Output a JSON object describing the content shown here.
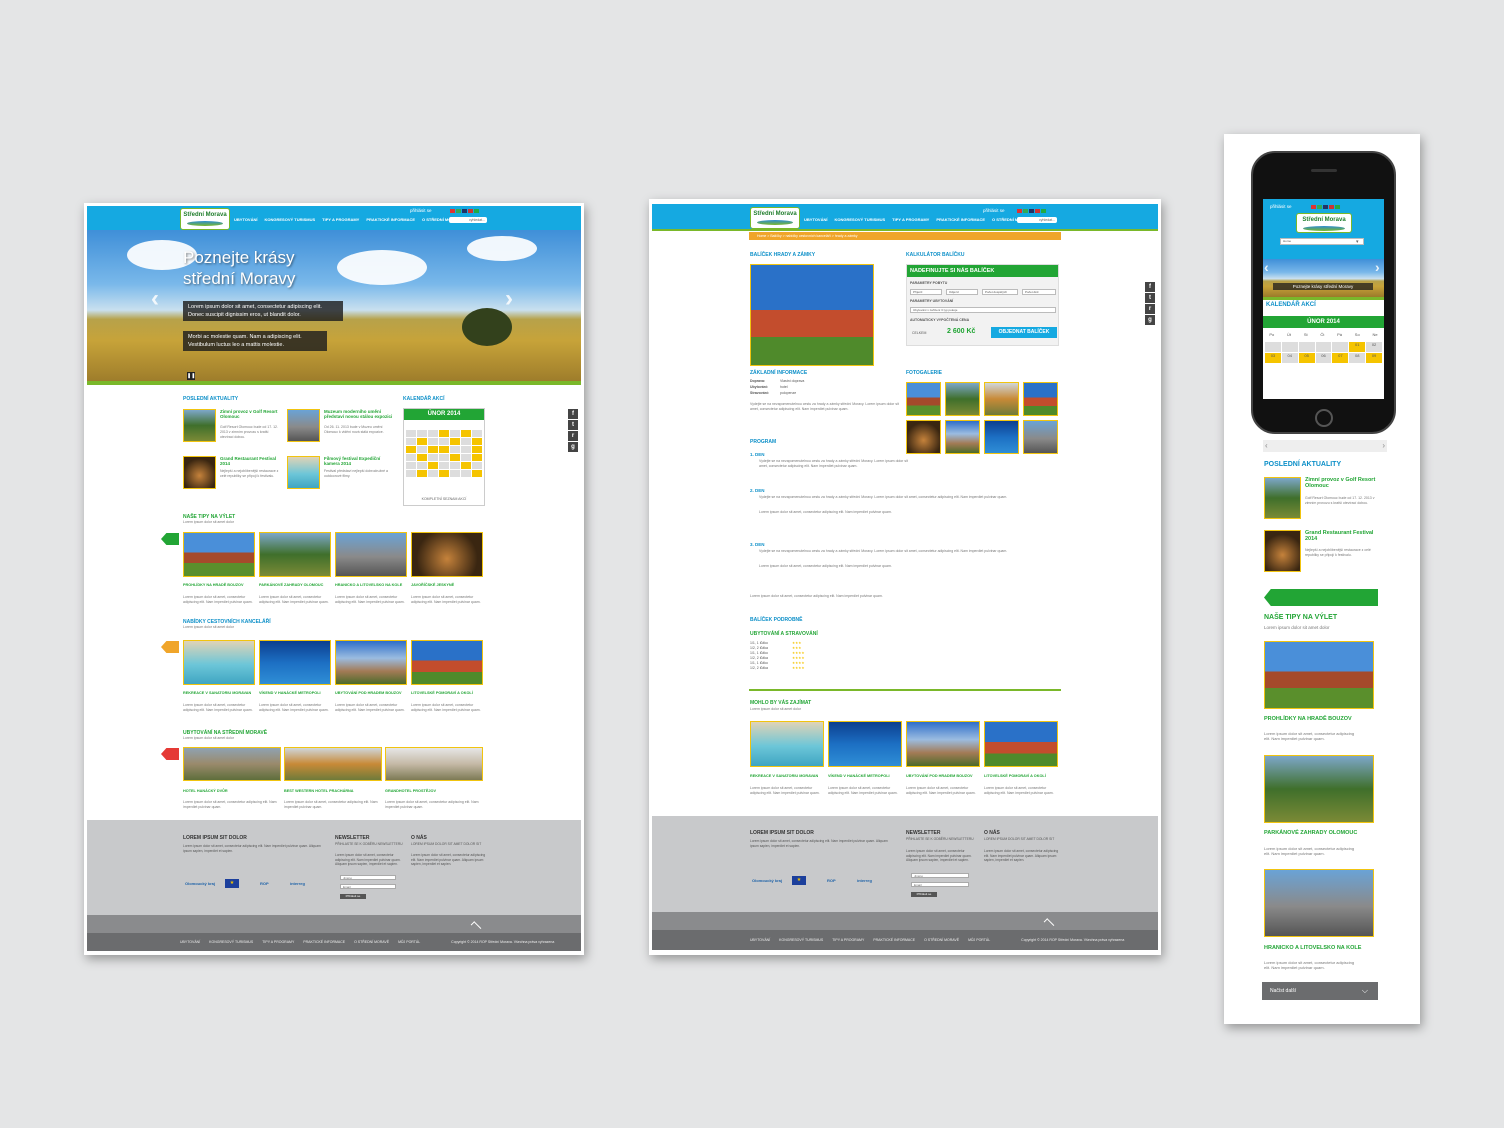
{
  "logo_text": "Střední Morava",
  "menu": [
    "UBYTOVÁNÍ",
    "KONGRESOVÝ TURISMUS",
    "TIPY A PROGRAMY",
    "PRAKTICKÉ INFORMACE",
    "O STŘEDNÍ MORAVĚ"
  ],
  "login": "přihlásit  se",
  "search_placeholder": "vyhledat...",
  "home": {
    "hero_title_1": "Poznejte krásy",
    "hero_title_2": "střední Moravy",
    "hero_text_1": "Lorem ipsum dolor sit amet, consectetur adipiscing elit. Donec suscipit dignissim eros, ut blandit dolor.",
    "hero_text_2": "Morbi ac molestie quam. Nam a adipiscing elit. Vestibulum luctus leo a mattis molestie.",
    "news_title": "POSLEDNÍ AKTUALITY",
    "news": [
      {
        "title": "Zimní provoz v Golf Resort Olomouc",
        "text": "Golf Resort Olomouc bude od 17. 12. 2013 v zimním provozu s kratší otevírací dobou."
      },
      {
        "title": "Muzeum moderního umění představí novou stálou expozici",
        "text": "Od 26. 11. 2013 bude v Muzeu umění Olomouc k vidění nová stálá expozice."
      },
      {
        "title": "Grand Restaurant Festival 2014",
        "text": "Nejlepší a nejoblíbenější restaurace z celé republiky se připojí k festivalu."
      },
      {
        "title": "Filmový festival Expediční kamera 2014",
        "text": "Festival představí nejlepší dobrodružné a outdoorové filmy."
      }
    ],
    "calendar_title": "KALENDÁŘ AKCÍ",
    "calendar_month": "ÚNOR 2014",
    "calendar_days": [
      "Po",
      "Út",
      "St",
      "Čt",
      "Pá",
      "So",
      "Ne"
    ],
    "calendar_link": "KOMPLETNÍ SEZNAM AKCÍ",
    "tips_title": "NAŠE TIPY NA VÝLET",
    "tips_sub": "Lorem ipsum dolor sit amet dolor",
    "tips": [
      "PROHLÍDKY NA HRADĚ BOUZOV",
      "PARKÁNOVÉ ZAHRADY OLOMOUC",
      "HRANICKO A LITOVELSKO NA KOLE",
      "JAVOŘÍČSKÉ JESKYNĚ"
    ],
    "item_text": "Lorem ipsum dolor sit amet, consectetur adipiscing elit. Nam imperdiet pulvinar quam.",
    "agencies_title": "NABÍDKY CESTOVNÍCH KANCELÁŘÍ",
    "agencies_sub": "Lorem ipsum dolor sit amet dolor",
    "agencies": [
      "REKREACE V SANATORIU MORAVAN",
      "VÍKEND V HANÁCKÉ METROPOLI",
      "UBYTOVÁNÍ POD HRADEM BOUZOV",
      "LITOVELSKÉ POMORAVÍ A OKOLÍ"
    ],
    "stay_title": "UBYTOVÁNÍ NA STŘEDNÍ MORAVĚ",
    "stay_sub": "Lorem ipsum dolor sit amet dolor",
    "stays": [
      "HOTEL HANÁCKÝ DVŮR",
      "BEST WESTERN HOTEL PRACHÁRNA",
      "GRANDHOTEL PROSTĚJOV"
    ]
  },
  "footer": {
    "col1_title": "LOREM IPSUM SIT DOLOR",
    "col1_text": "Lorem ipsum dolor sit amet, consectetur adipiscing elit. Nam imperdiet pulvinar quam. Aliquam ipsum sapien, imperdiet et sapien.",
    "newsletter_title": "NEWSLETTER",
    "newsletter_sub": "PŘIHLASTE SE K ODBĚRU NEWSLETTERU",
    "name_ph": "Jméno",
    "email_ph": "Email",
    "subscribe": "Přihlásit se",
    "about_title": "O NÁS",
    "about_text": "LOREM IPSUM DOLOR SIT AMET DOLOR SIT",
    "logos": [
      "Olomoucký kraj",
      "ROP",
      "interreg"
    ],
    "copyright": "Copyright © 2014 ROP Střední Morava. Všechna práva vyhrazena",
    "bottom_menu": [
      "UBYTOVÁNÍ",
      "KONGRESOVÝ TURISMUS",
      "TIPY A PROGRAMY",
      "PRAKTICKÉ INFORMACE",
      "O STŘEDNÍ MORAVĚ",
      "MŮJ PORTÁL"
    ]
  },
  "detail": {
    "breadcrumb": "Home > Balíčky > nabídky cestovních kanceláří > hrady a zámky",
    "package_title": "BALÍČEK HRADY A ZÁMKY",
    "calc_title": "KALKULÁTOR BALÍČKU",
    "calc_head": "NADEFINUJTE SI NÁS BALÍČEK",
    "calc_params": "PARAMETRY POBYTU",
    "calc_selects": [
      "Příjezd",
      "Odjezd",
      "Počet dospělých",
      "Počet dětí"
    ],
    "calc_accom": "PARAMETRY UBYTOVÁNÍ",
    "calc_accom_select": "Ubytování v zařízení 3 typ pokoje",
    "calc_price_label": "AUTOMATICKY VYPOČTENÁ CENA",
    "calc_total_label": "CELKEM",
    "calc_price": "2 600 Kč",
    "calc_button": "OBJEDNAT BALÍČEK",
    "basic_info": "ZÁKLADNÍ INFORMACE",
    "info": [
      [
        "Doprava:",
        "Vlastní doprava"
      ],
      [
        "Ubytování:",
        "hotel"
      ],
      [
        "Stravování:",
        "polopenze"
      ]
    ],
    "gallery": "FOTOGALERIE",
    "program": "PROGRAM",
    "days": [
      "1. DEN",
      "2. DEN",
      "3. DEN"
    ],
    "detail_title": "BALÍČEK PODROBNĚ",
    "accom_title": "UBYTOVÁNÍ A STRAVOVÁNÍ",
    "rooms": [
      "1/1, 1 lůžko",
      "1/2, 2 lůžka",
      "1/1, 1 lůžko",
      "1/2, 2 lůžka",
      "1/1, 1 lůžko",
      "1/2, 2 lůžka"
    ],
    "related_title": "MOHLO BY VÁS ZAJÍMAT",
    "related_sub": "Lorem ipsum dolor sit amet dolor",
    "body_text": "Vydejte se na nezapomenutelnou cestu za hrady a zámky střední Moravy. Lorem ipsum dolor sit amet, consectetur adipiscing elit. Nam imperdiet pulvinar quam."
  },
  "mobile": {
    "select": "Home",
    "hero": "Poznejte krásy střední Moravy",
    "calendar_title": "KALENDÁŘ AKCÍ",
    "calendar_month": "ÚNOR 2014",
    "days": [
      "Po",
      "Út",
      "St",
      "Čt",
      "Pá",
      "So",
      "Ne"
    ],
    "dates": [
      "",
      "",
      "",
      "",
      "",
      "01",
      "02",
      "03",
      "04",
      "05",
      "06",
      "07",
      "08",
      "09"
    ],
    "news_title": "POSLEDNÍ AKTUALITY",
    "news": [
      "Zimní provoz v Golf Resort Olomouc",
      "Grand Restaurant Festival 2014"
    ],
    "tips_title": "NAŠE TIPY NA VÝLET",
    "tips_sub": "Lorem ipsum dolor sit amet dolor",
    "tips": [
      "PROHLÍDKY NA HRADĚ BOUZOV",
      "PARKÁNOVÉ ZAHRADY OLOMOUC",
      "HRANICKO A LITOVELSKO NA KOLE"
    ],
    "load_more": "Načíst další"
  },
  "colors": {
    "blue": "#15a9e1",
    "green": "#22a535",
    "yellow": "#f5c400",
    "orange": "#f0a52a",
    "red": "#e53935"
  }
}
